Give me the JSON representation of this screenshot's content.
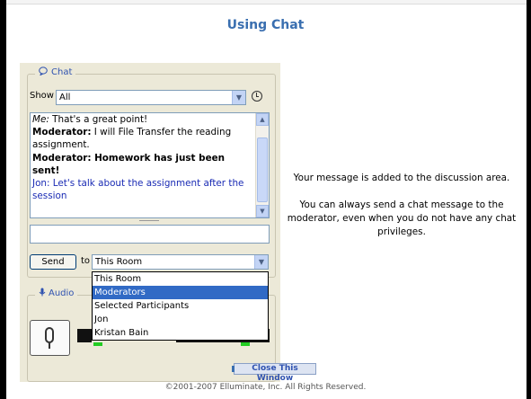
{
  "page": {
    "title": "Using Chat"
  },
  "chat": {
    "legend": "Chat",
    "show_label": "Show",
    "show_value": "All",
    "transcript": [
      {
        "speaker": "Me:",
        "text": " That's a great point!",
        "style": "me"
      },
      {
        "speaker": "Moderator:",
        "text": " I will File Transfer the reading assignment.",
        "style": "mod"
      },
      {
        "speaker": "",
        "text": "Moderator: Homework has just been sent!",
        "style": "bold"
      },
      {
        "speaker": "",
        "text": "Jon: Let's talk about the assignment after the session",
        "style": "blue"
      }
    ],
    "send_label": "Send",
    "to_label": "to",
    "to_value": "This Room",
    "dropdown_options": [
      "This Room",
      "Moderators",
      "Selected Participants",
      "Jon",
      "Kristan Bain"
    ],
    "dropdown_selected_index": 1
  },
  "audio": {
    "legend": "Audio"
  },
  "info": {
    "line1": "Your message is added to the discussion area.",
    "line2": "You can always send a chat message to the moderator, even when you do not have any chat privileges."
  },
  "footer": {
    "close_label": "Close This Window",
    "copyright": "©2001-2007 Elluminate, Inc. All Rights Reserved."
  },
  "colors": {
    "title": "#3a6fb0",
    "panel_bg": "#ece9d8",
    "selection": "#316ac5",
    "blue_message": "#1a2bb4"
  },
  "icons": [
    "chat-bubble-icon",
    "clock-icon",
    "chevron-down-icon",
    "scroll-up-icon",
    "scroll-down-icon",
    "audio-icon",
    "microphone-icon"
  ]
}
